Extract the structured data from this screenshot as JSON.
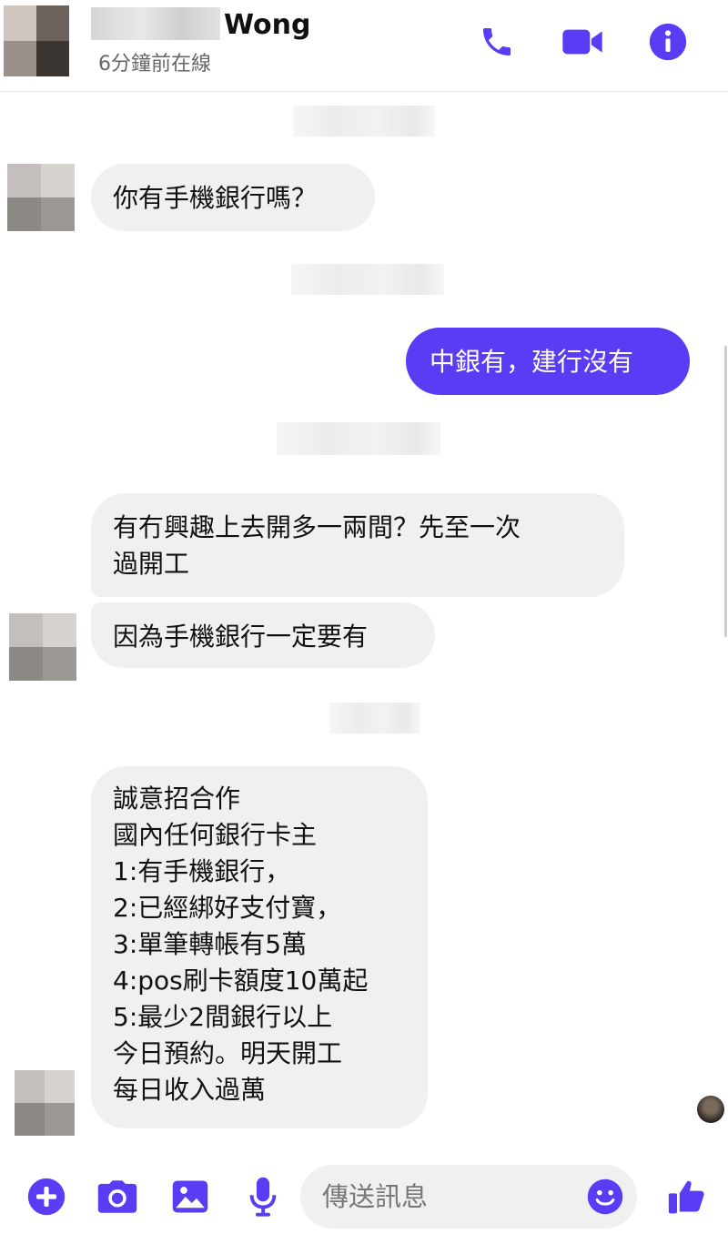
{
  "header": {
    "contact_name": "Wong",
    "status": "6分鐘前在線",
    "icons": [
      "phone-icon",
      "video-camera-icon",
      "info-icon"
    ]
  },
  "messages": [
    {
      "direction": "incoming",
      "text": "你有手機銀行嗎？"
    },
    {
      "direction": "outgoing",
      "text": "中銀有，建行沒有"
    },
    {
      "direction": "incoming",
      "text": "有冇興趣上去開多一兩間？先至一次\n過開工"
    },
    {
      "direction": "incoming",
      "text": "因為手機銀行一定要有"
    },
    {
      "direction": "incoming",
      "text": "誠意招合作\n國內任何銀行卡主\n1:有手機銀行，\n2:已經綁好支付寶，\n3:單筆轉帳有5萬\n4:pos刷卡額度10萬起\n5:最少2間銀行以上\n今日預約。明天開工\n每日收入過萬"
    }
  ],
  "composer": {
    "placeholder": "傳送訊息",
    "icons": [
      "plus-icon",
      "camera-icon",
      "image-icon",
      "microphone-icon",
      "emoji-icon",
      "thumbs-up-icon"
    ]
  },
  "colors": {
    "accent": "#5b3cf5",
    "incoming_bubble": "#f0f0f0",
    "outgoing_text": "#ffffff"
  }
}
